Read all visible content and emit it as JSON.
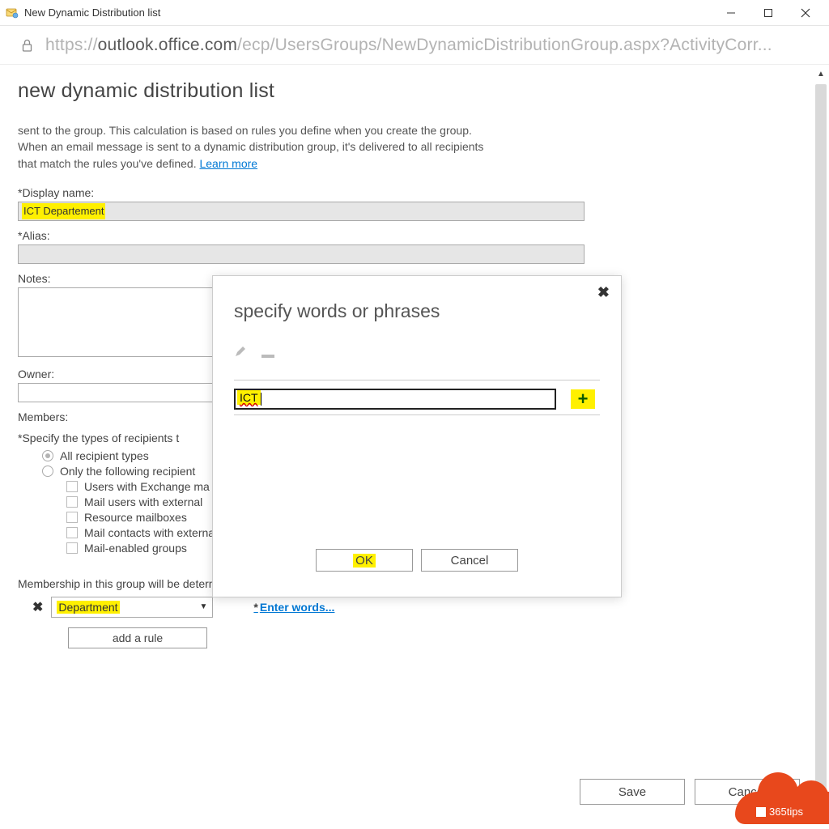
{
  "titlebar": {
    "title": "New Dynamic Distribution list"
  },
  "urlbar": {
    "display": "https://outlook.office.com/ecp/UsersGroups/NewDynamicDistributionGroup.aspx?ActivityCorr..."
  },
  "page": {
    "heading": "new dynamic distribution list",
    "intro_line1": "sent to the group. This calculation is based on rules you define when you create the group.",
    "intro_line2": "When an email message is sent to a dynamic distribution group, it's delivered to all recipients",
    "intro_line3": "that match the rules you've defined. ",
    "learn_more": "Learn more"
  },
  "fields": {
    "display_name_label": "*Display name:",
    "display_name_value": "ICT Departement",
    "alias_label": "*Alias:",
    "alias_value": "",
    "notes_label": "Notes:",
    "notes_value": "",
    "owner_label": "Owner:",
    "owner_value": ""
  },
  "members": {
    "label": "Members:",
    "specify": "*Specify the types of recipients t",
    "radio_all": "All recipient types",
    "radio_only": "Only the following recipient",
    "cb1": "Users with Exchange ma",
    "cb2": "Mail users with external",
    "cb3": "Resource mailboxes",
    "cb4": "Mail contacts with external email addresses",
    "cb5": "Mail-enabled groups"
  },
  "rules": {
    "text": "Membership in this group will be determined by the rules you set up below.",
    "select_value": "Department",
    "enter_words": "Enter words...",
    "add_rule": "add a rule"
  },
  "actions": {
    "save": "Save",
    "cancel": "Cancel"
  },
  "modal": {
    "title": "specify words or phrases",
    "input_value": "ICT",
    "ok": "OK",
    "cancel": "Cancel"
  },
  "watermark": {
    "text": "365tips"
  }
}
